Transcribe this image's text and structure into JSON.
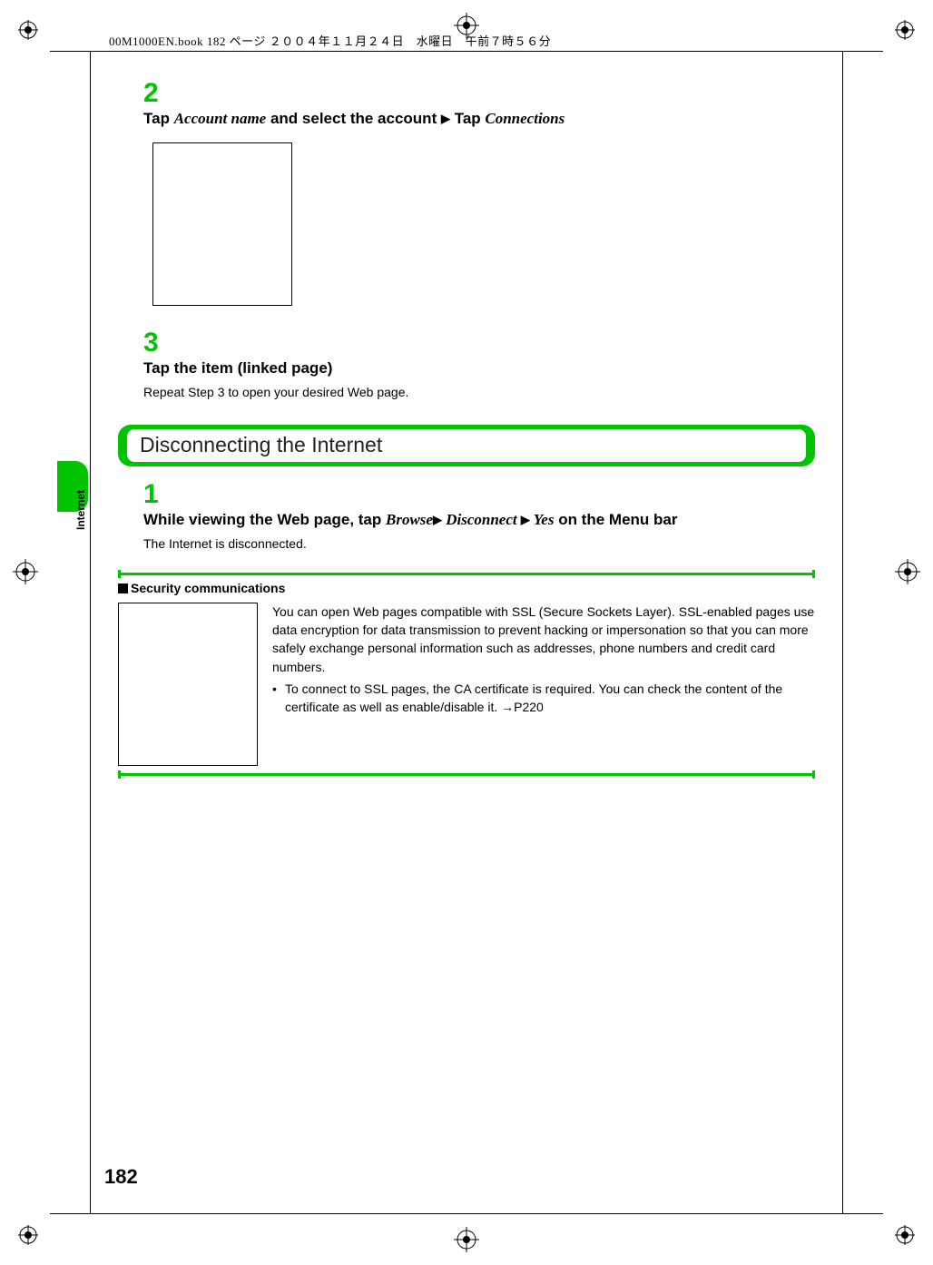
{
  "header": {
    "crop_label": "00M1000EN.book  182 ページ  ２００４年１１月２４日　水曜日　午前７時５６分"
  },
  "side": {
    "tab_label": "Internet"
  },
  "step2": {
    "num": "2",
    "h_p1": "Tap ",
    "h_i1": "Account name",
    "h_p2": " and select the account ",
    "h_p3": " Tap ",
    "h_i2": "Connections"
  },
  "step3": {
    "num": "3",
    "heading": "Tap the item (linked page)",
    "body": "Repeat Step 3 to open your desired Web page."
  },
  "section": {
    "title": "Disconnecting the Internet"
  },
  "step1": {
    "num": "1",
    "h_p1": "While viewing the Web page, tap ",
    "h_i1": "Browse",
    "h_i2": " Disconnect ",
    "h_i3": " Yes",
    "h_p2": " on the Menu bar",
    "body": "The Internet is disconnected."
  },
  "security": {
    "title": "Security communications",
    "para": "You can open Web pages compatible with SSL (Secure Sockets Layer). SSL-enabled pages use data encryption for data transmission to prevent hacking or impersonation so that you can more safely exchange personal information such as addresses, phone numbers and credit card numbers.",
    "bullet": "To connect to SSL pages, the CA certificate is required. You can check the content of the certificate as well as enable/disable it. →P220"
  },
  "pagenum": "182"
}
